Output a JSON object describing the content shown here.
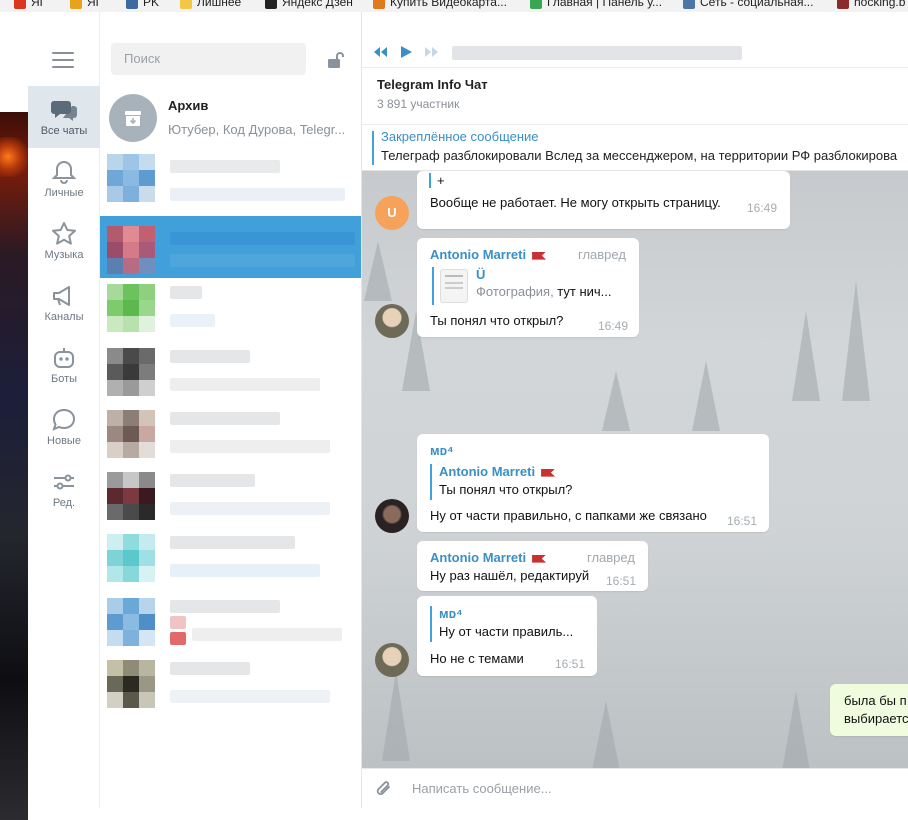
{
  "bookmarks": [
    {
      "label": "ЯГ",
      "color": "#d9381e"
    },
    {
      "label": "ЯГ",
      "color": "#e9a21a"
    },
    {
      "label": "PK",
      "color": "#3b6aa0"
    },
    {
      "label": "Лишнее",
      "color": "#f3c744"
    },
    {
      "label": "Яндекс Дзен",
      "color": "#222222"
    },
    {
      "label": "Купить Видеокарта...",
      "color": "#e07a1f"
    },
    {
      "label": "Главная | Панель у...",
      "color": "#3aa655"
    },
    {
      "label": "Сеть - социальная...",
      "color": "#4a76a8"
    },
    {
      "label": "hocking.b",
      "color": "#8a2a2a"
    }
  ],
  "sidebar": {
    "folders": [
      {
        "label": "Все чаты",
        "icon": "chats-icon"
      },
      {
        "label": "Личные",
        "icon": "bell-icon"
      },
      {
        "label": "Музыка",
        "icon": "star-icon"
      },
      {
        "label": "Каналы",
        "icon": "megaphone-icon"
      },
      {
        "label": "Боты",
        "icon": "bot-icon"
      },
      {
        "label": "Новые",
        "icon": "speech-icon"
      },
      {
        "label": "Ред.",
        "icon": "sliders-icon"
      }
    ]
  },
  "chat_list": {
    "search_placeholder": "Поиск",
    "archive": {
      "name": "Архив",
      "preview": "Ютубер, Код Дурова, Telegr..."
    }
  },
  "chat": {
    "title": "Telegram Info Чат",
    "members": "3 891 участник",
    "pinned": {
      "title": "Закреплённое сообщение",
      "text": "Телеграф разблокировали  Вслед за мессенджером, на территории РФ разблокирова"
    },
    "messages": [
      {
        "avatar_letter": "U",
        "quote_tail": "+",
        "text": "Вообще не работает. Не могу открыть страницу.",
        "time": "16:49"
      },
      {
        "sender": "Antonio Marreti",
        "role": "главред",
        "reply_name": "Ü",
        "reply_kind": "Фотография,",
        "reply_text": " тут нич...",
        "text": "Ты понял что открыл?",
        "time": "16:49"
      },
      {
        "sender": "мᴅ⁴",
        "reply_name": "Antonio Marreti",
        "reply_text": "Ты понял что открыл?",
        "text": "Ну от части правильно, с папками же связано",
        "time": "16:51"
      },
      {
        "sender": "Antonio Marreti",
        "role": "главред",
        "text": "Ну раз нашёл, редактируй",
        "time": "16:51"
      },
      {
        "reply_name": "мᴅ⁴",
        "reply_text": "Ну от части правиль...",
        "text": "Но не с темами",
        "time": "16:51"
      },
      {
        "text_line1": "была бы п",
        "text_line2": "выбираетс"
      }
    ],
    "composer_placeholder": "Написать сообщение..."
  }
}
